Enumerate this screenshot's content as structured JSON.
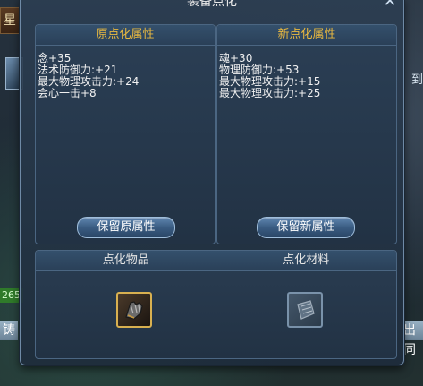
{
  "background": {
    "left_tab_text": "星",
    "left_number": "265",
    "left_bottom_text": "铸",
    "right_text": "到",
    "right_bottom_text": "出同"
  },
  "dialog": {
    "title": "装备点化",
    "close_icon": "close-x",
    "original_panel": {
      "heading": "原点化属性",
      "attributes": [
        "念+35",
        "法术防御力:+21",
        "最大物理攻击力:+24",
        "会心一击+8"
      ],
      "button_label": "保留原属性"
    },
    "new_panel": {
      "heading": "新点化属性",
      "attributes": [
        "魂+30",
        "物理防御力:+53",
        "最大物理攻击力:+15",
        "最大物理攻击力:+25"
      ],
      "button_label": "保留新属性"
    },
    "bottom": {
      "item_label": "点化物品",
      "material_label": "点化材料",
      "item_icon": "gauntlet-icon",
      "material_icon": "scroll-icon"
    }
  },
  "colors": {
    "heading": "#e8b840",
    "panel_border": "#4b6682",
    "button": "#3a5c82",
    "item_slot_border": "#d8b050"
  }
}
